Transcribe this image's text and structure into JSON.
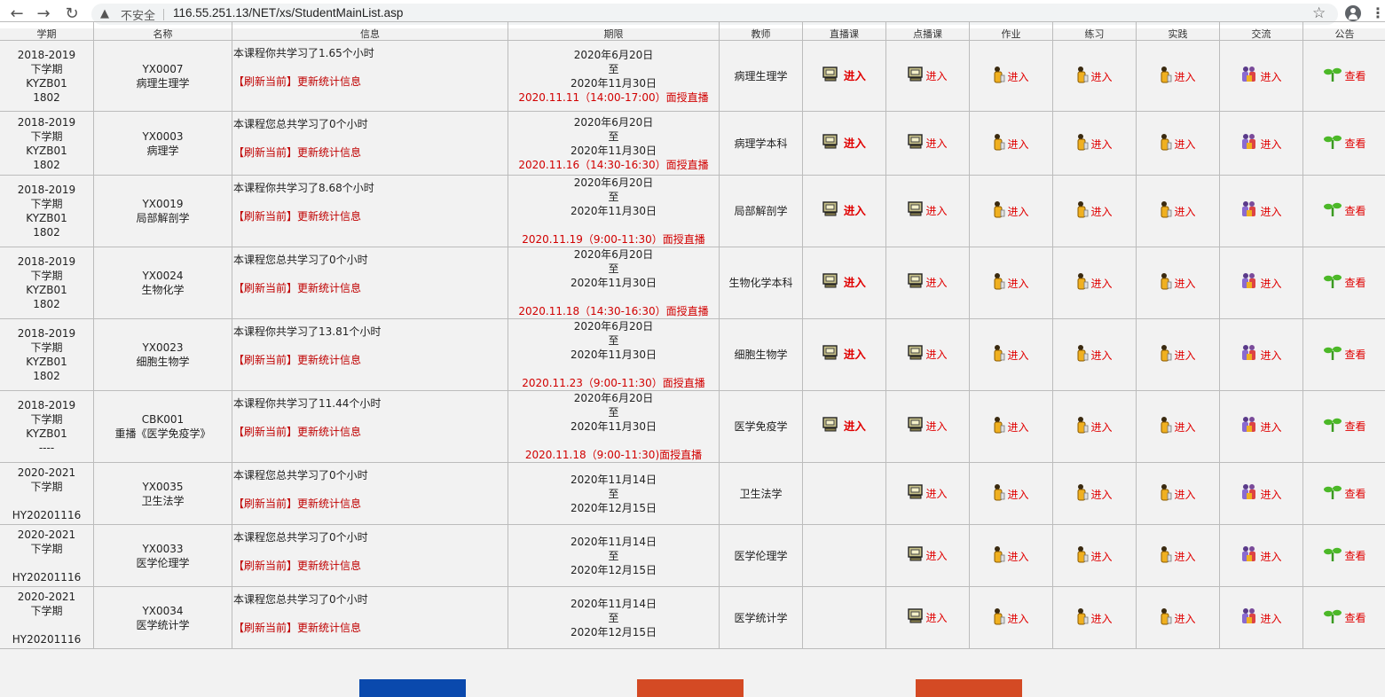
{
  "browser": {
    "insecure_label": "不安全",
    "url": "116.55.251.13/NET/xs/StudentMainList.asp"
  },
  "table": {
    "headers": [
      "学期",
      "名称",
      "信息",
      "期限",
      "教师",
      "直播课",
      "点播课",
      "作业",
      "练习",
      "实践",
      "交流",
      "公告"
    ],
    "rows": [
      {
        "term": [
          "2018-2019",
          "下学期",
          "KYZB01",
          "1802"
        ],
        "code": "YX0007",
        "name": "病理生理学",
        "study": "本课程你共学习了1.65个小时",
        "refresh": "【刷新当前】更新统计信息",
        "start": "2020年6月20日",
        "to": "至",
        "end": "2020年11月30日",
        "live": "2020.11.11（14:00-17:00）面授直播",
        "teacher": "病理生理学",
        "live_enter": "进入"
      },
      {
        "term": [
          "2018-2019",
          "下学期",
          "KYZB01",
          "1802"
        ],
        "code": "YX0003",
        "name": "病理学",
        "study": "本课程您总共学习了0个小时",
        "refresh": "【刷新当前】更新统计信息",
        "start": "2020年6月20日",
        "to": "至",
        "end": "2020年11月30日",
        "live": "2020.11.16（14:30-16:30）面授直播",
        "teacher": "病理学本科",
        "live_enter": "进入"
      },
      {
        "term": [
          "2018-2019",
          "下学期",
          "KYZB01",
          "1802"
        ],
        "code": "YX0019",
        "name": "局部解剖学",
        "study": "本课程你共学习了8.68个小时",
        "refresh": "【刷新当前】更新统计信息",
        "start": "2020年6月20日",
        "to": "至",
        "end": "2020年11月30日",
        "live": "2020.11.19（9:00-11:30）面授直播",
        "teacher": "局部解剖学",
        "live_enter": "进入"
      },
      {
        "term": [
          "2018-2019",
          "下学期",
          "KYZB01",
          "1802"
        ],
        "code": "YX0024",
        "name": "生物化学",
        "study": "本课程您总共学习了0个小时",
        "refresh": "【刷新当前】更新统计信息",
        "start": "2020年6月20日",
        "to": "至",
        "end": "2020年11月30日",
        "live": "2020.11.18（14:30-16:30）面授直播",
        "teacher": "生物化学本科",
        "live_enter": "进入"
      },
      {
        "term": [
          "2018-2019",
          "下学期",
          "KYZB01",
          "1802"
        ],
        "code": "YX0023",
        "name": "细胞生物学",
        "study": "本课程你共学习了13.81个小时",
        "refresh": "【刷新当前】更新统计信息",
        "start": "2020年6月20日",
        "to": "至",
        "end": "2020年11月30日",
        "live": "2020.11.23（9:00-11:30）面授直播",
        "teacher": "细胞生物学",
        "live_enter": "进入"
      },
      {
        "term": [
          "2018-2019",
          "下学期",
          "KYZB01",
          "----"
        ],
        "code": "CBK001",
        "name": "重播《医学免疫学》",
        "study": "本课程你共学习了11.44个小时",
        "refresh": "【刷新当前】更新统计信息",
        "start": "2020年6月20日",
        "to": "至",
        "end": "2020年11月30日",
        "live": "2020.11.18（9:00-11:30)面授直播",
        "teacher": "医学免疫学",
        "live_enter": "进入"
      },
      {
        "term": [
          "2020-2021",
          "下学期",
          "",
          "HY20201116"
        ],
        "code": "YX0035",
        "name": "卫生法学",
        "study": "本课程您总共学习了0个小时",
        "refresh": "【刷新当前】更新统计信息",
        "start": "2020年11月14日",
        "to": "至",
        "end": "2020年12月15日",
        "live": "",
        "teacher": "卫生法学",
        "live_enter": ""
      },
      {
        "term": [
          "2020-2021",
          "下学期",
          "",
          "HY20201116"
        ],
        "code": "YX0033",
        "name": "医学伦理学",
        "study": "本课程您总共学习了0个小时",
        "refresh": "【刷新当前】更新统计信息",
        "start": "2020年11月14日",
        "to": "至",
        "end": "2020年12月15日",
        "live": "",
        "teacher": "医学伦理学",
        "live_enter": ""
      },
      {
        "term": [
          "2020-2021",
          "下学期",
          "",
          "HY20201116"
        ],
        "code": "YX0034",
        "name": "医学统计学",
        "study": "本课程您总共学习了0个小时",
        "refresh": "【刷新当前】更新统计信息",
        "start": "2020年11月14日",
        "to": "至",
        "end": "2020年12月15日",
        "live": "",
        "teacher": "医学统计学",
        "live_enter": ""
      }
    ],
    "enter_label": "进入",
    "view_label": "查看"
  },
  "colors": {
    "button_blue": "#0a49ad",
    "button_orange": "#d44a24",
    "red_text": "#e00000"
  },
  "icons": {
    "live": "computer-icon",
    "vod": "computer-icon",
    "homework": "pencil-person-icon",
    "practice": "pencil-person-icon",
    "practical": "pencil-person-icon",
    "exchange": "people-group-icon",
    "notice": "sprout-icon"
  }
}
